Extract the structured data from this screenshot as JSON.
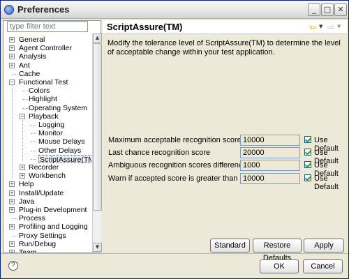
{
  "window": {
    "title": "Preferences"
  },
  "filter": {
    "placeholder": "type filter text"
  },
  "tree": [
    {
      "label": "General",
      "expander": "+",
      "depth": 0
    },
    {
      "label": "Agent Controller",
      "expander": "+",
      "depth": 0
    },
    {
      "label": "Analysis",
      "expander": "+",
      "depth": 0
    },
    {
      "label": "Ant",
      "expander": "+",
      "depth": 0
    },
    {
      "label": "Cache",
      "expander": "",
      "depth": 0
    },
    {
      "label": "Functional Test",
      "expander": "-",
      "depth": 0
    },
    {
      "label": "Colors",
      "expander": "",
      "depth": 1
    },
    {
      "label": "Highlight",
      "expander": "",
      "depth": 1
    },
    {
      "label": "Operating System",
      "expander": "",
      "depth": 1
    },
    {
      "label": "Playback",
      "expander": "-",
      "depth": 1
    },
    {
      "label": "Logging",
      "expander": "",
      "depth": 2
    },
    {
      "label": "Monitor",
      "expander": "",
      "depth": 2
    },
    {
      "label": "Mouse Delays",
      "expander": "",
      "depth": 2
    },
    {
      "label": "Other Delays",
      "expander": "",
      "depth": 2
    },
    {
      "label": "ScriptAssure(TM)",
      "expander": "",
      "depth": 2,
      "selected": true
    },
    {
      "label": "Recorder",
      "expander": "+",
      "depth": 1
    },
    {
      "label": "Workbench",
      "expander": "+",
      "depth": 1
    },
    {
      "label": "Help",
      "expander": "+",
      "depth": 0
    },
    {
      "label": "Install/Update",
      "expander": "+",
      "depth": 0
    },
    {
      "label": "Java",
      "expander": "+",
      "depth": 0
    },
    {
      "label": "Plug-in Development",
      "expander": "+",
      "depth": 0
    },
    {
      "label": "Process",
      "expander": "",
      "depth": 0
    },
    {
      "label": "Profiling and Logging",
      "expander": "+",
      "depth": 0
    },
    {
      "label": "Proxy Settings",
      "expander": "",
      "depth": 0
    },
    {
      "label": "Run/Debug",
      "expander": "+",
      "depth": 0
    },
    {
      "label": "Team",
      "expander": "+",
      "depth": 0
    }
  ],
  "page": {
    "title": "ScriptAssure(TM)",
    "description": "Modify the tolerance level of ScriptAssure(TM) to determine the level of acceptable change within your test application.",
    "settings": [
      {
        "label": "Maximum acceptable recognition score",
        "value": "10000",
        "default_label": "Use Default",
        "checked": true
      },
      {
        "label": "Last chance recognition score",
        "value": "20000",
        "default_label": "Use Default",
        "checked": true
      },
      {
        "label": "Ambiguous recognition scores difference threshold",
        "value": "1000",
        "default_label": "Use Default",
        "checked": true
      },
      {
        "label": "Warn if accepted score is greater than",
        "value": "10000",
        "default_label": "Use Default",
        "checked": true
      }
    ],
    "buttons": {
      "standard": "Standard",
      "restore": "Restore Defaults",
      "apply": "Apply"
    }
  },
  "footer": {
    "ok": "OK",
    "cancel": "Cancel"
  },
  "icons": {
    "app": "eclipse-icon",
    "back": "back-arrow-icon",
    "forward": "forward-arrow-icon",
    "help": "help-icon"
  }
}
